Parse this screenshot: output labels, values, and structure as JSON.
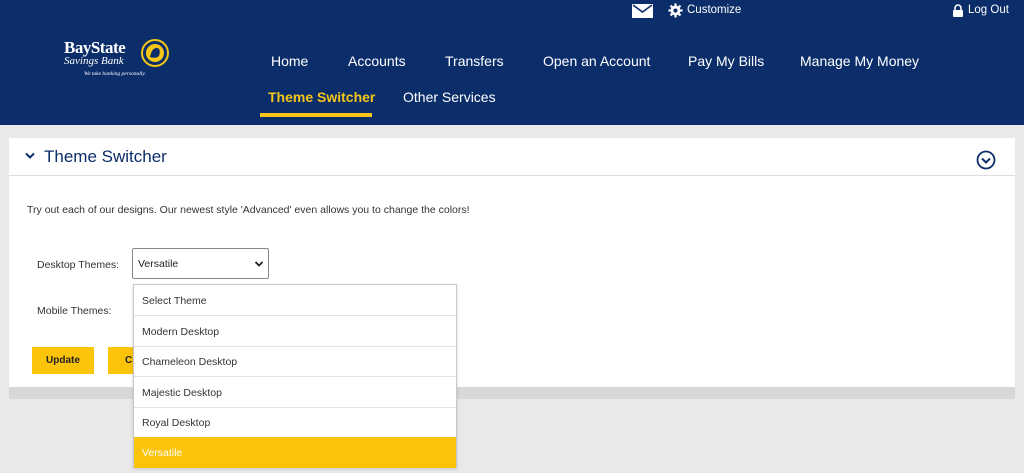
{
  "header": {
    "customize_label": "Customize",
    "logout_label": "Log Out",
    "logo": {
      "line1": "BayState",
      "line2": "Savings Bank",
      "tagline": "We take banking personally."
    },
    "nav": [
      {
        "label": "Home"
      },
      {
        "label": "Accounts"
      },
      {
        "label": "Transfers"
      },
      {
        "label": "Open an Account"
      },
      {
        "label": "Pay My Bills"
      },
      {
        "label": "Manage My Money"
      },
      {
        "label": "Theme Switcher",
        "active": true
      },
      {
        "label": "Other Services"
      }
    ]
  },
  "panel": {
    "title": "Theme Switcher",
    "intro": "Try out each of our designs. Our newest style 'Advanced' even allows you to change the colors!",
    "desktop_label": "Desktop Themes:",
    "desktop_value": "Versatile",
    "mobile_label": "Mobile Themes:",
    "update_label": "Update",
    "second_button_label": "C"
  },
  "dropdown": {
    "options": [
      "Select Theme",
      "Modern Desktop",
      "Chameleon Desktop",
      "Majestic Desktop",
      "Royal Desktop",
      "Versatile"
    ],
    "selected": "Versatile"
  },
  "colors": {
    "header_bg": "#0b2e6a",
    "accent": "#f5c518",
    "button": "#fbc30a"
  },
  "icons": {
    "mail": "envelope-icon",
    "customize": "gear-icon",
    "logout": "lock-icon",
    "collapse": "chevron-down-icon",
    "panel_toggle": "circle-chevron-down-icon"
  }
}
